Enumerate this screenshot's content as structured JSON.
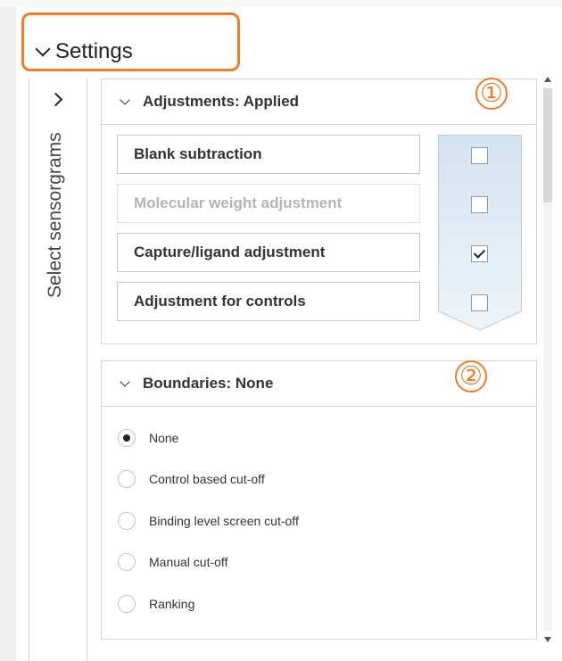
{
  "settings": {
    "title": "Settings"
  },
  "sidebar": {
    "label": "Select sensorgrams"
  },
  "adjustments": {
    "title": "Adjustments: Applied",
    "items": [
      {
        "label": "Blank subtraction",
        "enabled": true,
        "checked": false
      },
      {
        "label": "Molecular weight adjustment",
        "enabled": false,
        "checked": false
      },
      {
        "label": "Capture/ligand adjustment",
        "enabled": true,
        "checked": true
      },
      {
        "label": "Adjustment for controls",
        "enabled": true,
        "checked": false
      }
    ]
  },
  "boundaries": {
    "title": "Boundaries: None",
    "options": [
      {
        "label": "None",
        "selected": true
      },
      {
        "label": "Control based cut-off",
        "selected": false
      },
      {
        "label": "Binding level screen cut-off",
        "selected": false
      },
      {
        "label": "Manual cut-off",
        "selected": false
      },
      {
        "label": "Ranking",
        "selected": false
      }
    ]
  },
  "badges": [
    "①",
    "②"
  ],
  "colors": {
    "highlight": "#ee7d25",
    "arrow_panel": "#dde9f2"
  },
  "icons": [
    "chevron-down-icon",
    "chevron-right-icon",
    "checkmark-icon",
    "scroll-up-icon",
    "scroll-down-icon"
  ]
}
